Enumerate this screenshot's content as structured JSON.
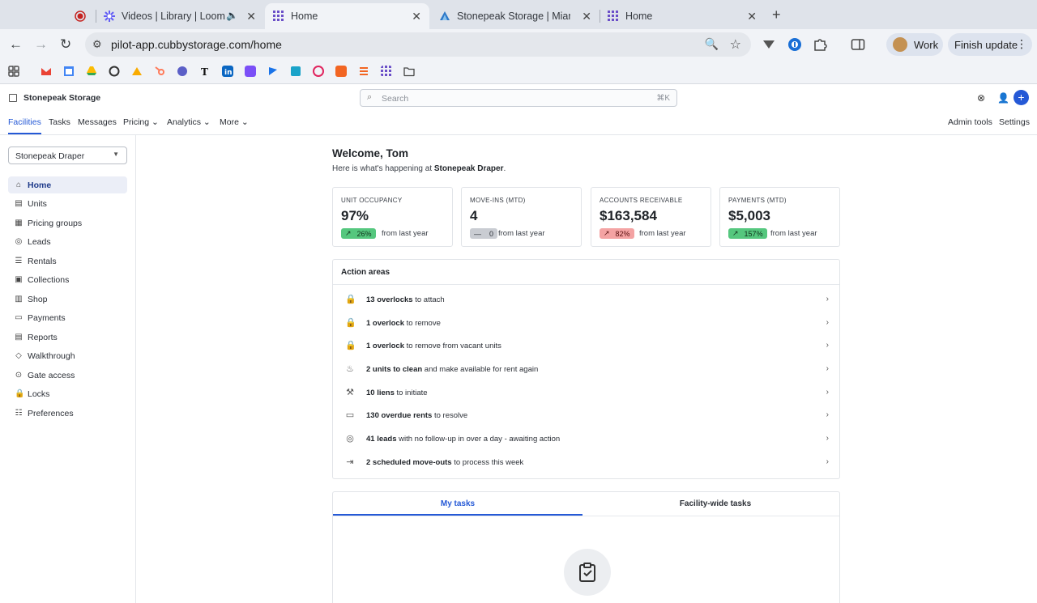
{
  "browser": {
    "tabs": [
      {
        "title": "",
        "icon": "record-icon",
        "recording": true
      },
      {
        "title": "Videos | Library | Loom",
        "icon": "loom-icon",
        "audio": true
      },
      {
        "title": "Home",
        "icon": "cubby-grid-icon",
        "active": true
      },
      {
        "title": "Stonepeak Storage | Miami &",
        "icon": "stonepeak-icon"
      },
      {
        "title": "Home",
        "icon": "cubby-grid-icon"
      }
    ],
    "url": "pilot-app.cubbystorage.com/home",
    "profile_label": "Work",
    "update_label": "Finish update",
    "bookmarks": [
      "gmail-icon",
      "calendar-icon",
      "drive-icon",
      "openai-icon",
      "analytics-icon",
      "hubspot-icon",
      "app-icon",
      "nyt-icon",
      "linkedin-icon",
      "app-icon",
      "app-icon",
      "app-icon",
      "app-icon",
      "app-icon",
      "app-icon",
      "grid-icon",
      "folder-icon"
    ]
  },
  "app": {
    "brand": "Stonepeak Storage",
    "search_placeholder": "Search",
    "search_shortcut": "⌘K",
    "nav": {
      "left": [
        {
          "label": "Facilities",
          "active": true
        },
        {
          "label": "Tasks"
        },
        {
          "label": "Messages"
        },
        {
          "label": "Pricing",
          "dropdown": true
        },
        {
          "label": "Analytics",
          "dropdown": true
        },
        {
          "label": "More",
          "dropdown": true
        }
      ],
      "right": [
        "Admin tools",
        "Settings"
      ]
    },
    "facility_select": "Stonepeak Draper",
    "sidebar": [
      {
        "label": "Home",
        "icon": "home-icon",
        "active": true
      },
      {
        "label": "Units",
        "icon": "units-icon"
      },
      {
        "label": "Pricing groups",
        "icon": "pricing-groups-icon"
      },
      {
        "label": "Leads",
        "icon": "leads-icon"
      },
      {
        "label": "Rentals",
        "icon": "rentals-icon"
      },
      {
        "label": "Collections",
        "icon": "collections-icon"
      },
      {
        "label": "Shop",
        "icon": "shop-icon"
      },
      {
        "label": "Payments",
        "icon": "payments-icon"
      },
      {
        "label": "Reports",
        "icon": "reports-icon"
      },
      {
        "label": "Walkthrough",
        "icon": "walkthrough-icon"
      },
      {
        "label": "Gate access",
        "icon": "gate-icon"
      },
      {
        "label": "Locks",
        "icon": "lock-icon"
      },
      {
        "label": "Preferences",
        "icon": "preferences-icon"
      }
    ],
    "welcome": "Welcome, Tom",
    "subtitle_prefix": "Here is what's happening at ",
    "subtitle_facility": "Stonepeak Draper",
    "subtitle_suffix": ".",
    "kpis": [
      {
        "label": "UNIT OCCUPANCY",
        "value": "97%",
        "change": "26%",
        "trend": "up",
        "from": "from last year"
      },
      {
        "label": "MOVE-INS (MTD)",
        "value": "4",
        "change": "0",
        "trend": "flat",
        "from": "from last year"
      },
      {
        "label": "ACCOUNTS RECEIVABLE",
        "value": "$163,584",
        "change": "82%",
        "trend": "down",
        "from": "from last year"
      },
      {
        "label": "PAYMENTS (MTD)",
        "value": "$5,003",
        "change": "157%",
        "trend": "up",
        "from": "from last year"
      }
    ],
    "action_areas_title": "Action areas",
    "action_areas": [
      {
        "bold": "13 overlocks",
        "rest": " to attach",
        "icon": "lock-icon"
      },
      {
        "bold": "1 overlock",
        "rest": " to remove",
        "icon": "lock-icon"
      },
      {
        "bold": "1 overlock",
        "rest": " to remove from vacant units",
        "icon": "lock-icon"
      },
      {
        "bold": "2 units to clean",
        "rest": " and make available for rent again",
        "icon": "broom-icon"
      },
      {
        "bold": "10 liens",
        "rest": " to initiate",
        "icon": "gavel-icon"
      },
      {
        "bold": "130 overdue rents",
        "rest": " to resolve",
        "icon": "bill-icon"
      },
      {
        "bold": "41 leads",
        "rest": " with no follow-up in over a day - awaiting action",
        "icon": "lead-search-icon"
      },
      {
        "bold": "2 scheduled move-outs",
        "rest": " to process this week",
        "icon": "move-out-icon"
      }
    ],
    "task_tabs": [
      {
        "label": "My tasks",
        "active": true
      },
      {
        "label": "Facility-wide tasks"
      }
    ],
    "colors": {
      "accent": "#2559d6",
      "up": "#55c77e",
      "down": "#f4a3a3",
      "flat": "#c9ccd2"
    }
  }
}
